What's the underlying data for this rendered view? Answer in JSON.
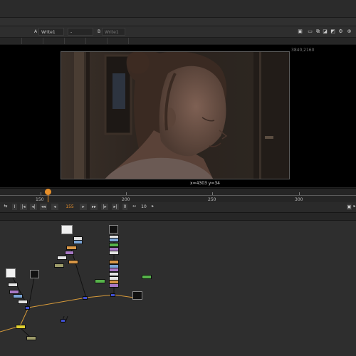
{
  "viewer_toolbar": {
    "channel_a_letter": "A",
    "channel_a_value": "Write1",
    "wipe_value": "-",
    "channel_b_letter": "B",
    "channel_b_value": "Write1",
    "icons": [
      "snapshot-icon",
      "region-icon",
      "compare-icon",
      "display-icon",
      "clip-warning-icon",
      "settings-icon",
      "lock-icon"
    ]
  },
  "viewer": {
    "resolution_label": "3840,2160",
    "coordinate_readout": "x=4303 y=34"
  },
  "timeline": {
    "tick_labels": [
      "150",
      "200",
      "250",
      "300"
    ],
    "current_frame": 155
  },
  "transport": {
    "frame_value": "155",
    "increment_value": "10",
    "buttons": [
      {
        "name": "first-frame-button",
        "glyph": "|◂"
      },
      {
        "name": "prev-keyframe-button",
        "glyph": "◂|"
      },
      {
        "name": "step-back-button",
        "glyph": "◂◂"
      },
      {
        "name": "play-backward-button",
        "glyph": "◂"
      },
      {
        "name": "play-forward-button",
        "glyph": "▸"
      },
      {
        "name": "step-forward-button",
        "glyph": "▸▸"
      },
      {
        "name": "next-keyframe-button",
        "glyph": "|▸"
      },
      {
        "name": "last-frame-button",
        "glyph": "▸|"
      }
    ]
  },
  "colors": {
    "accent": "#e8902a",
    "dot_node": "#3f4fd0",
    "grade_node": "#a879c5",
    "merge_node": "#56b34a",
    "transform_node": "#b8b8b8",
    "read_node": "#e2e2e2",
    "shuffle_node": "#d79646",
    "write_node": "#e0d030"
  }
}
